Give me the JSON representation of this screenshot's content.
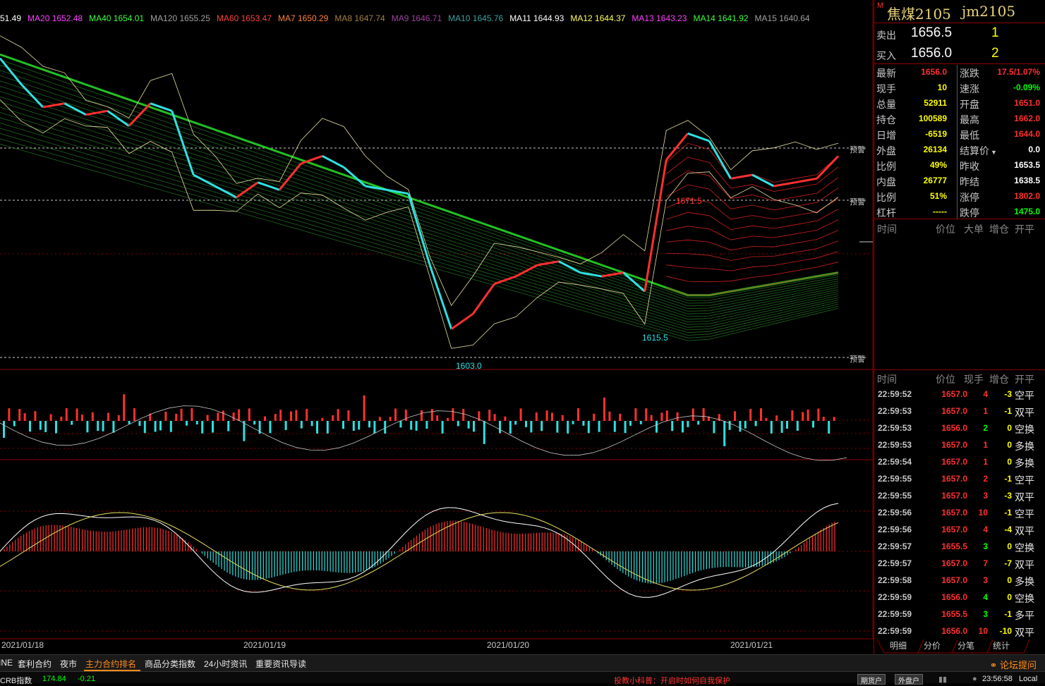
{
  "ma_legend": [
    {
      "label": "51.49",
      "color": "#ffffff"
    },
    {
      "label": "MA20 1652.48",
      "color": "#ff40ff"
    },
    {
      "label": "MA40 1654.01",
      "color": "#40ff40"
    },
    {
      "label": "MA120 1655.25",
      "color": "#a0a0a0"
    },
    {
      "label": "MA60 1653.47",
      "color": "#ff4040"
    },
    {
      "label": "MA7 1650.29",
      "color": "#ff8040"
    },
    {
      "label": "MA8 1647.74",
      "color": "#a08040"
    },
    {
      "label": "MA9 1646.71",
      "color": "#a040a0"
    },
    {
      "label": "MA10 1645.76",
      "color": "#40a0a0"
    },
    {
      "label": "MA11 1644.93",
      "color": "#ffffff"
    },
    {
      "label": "MA12 1644.37",
      "color": "#ffff60"
    },
    {
      "label": "MA13 1643.23",
      "color": "#ff40ff"
    },
    {
      "label": "MA14 1641.92",
      "color": "#40ff40"
    },
    {
      "label": "MA15 1640.64",
      "color": "#a0a0a0"
    }
  ],
  "alerts": [
    "预警",
    "预警",
    "预警"
  ],
  "price_labels": {
    "high": "1671.5",
    "low1": "1615.5",
    "low2": "1603.0"
  },
  "dates": [
    "2021/01/18",
    "2021/01/19",
    "2021/01/20",
    "2021/01/21"
  ],
  "chart_data": {
    "type": "line",
    "ylim": [
      1600,
      1690
    ],
    "x": [
      0,
      1,
      2,
      3,
      4,
      5,
      6,
      7,
      8,
      9,
      10,
      11,
      12,
      13,
      14,
      15,
      16,
      17,
      18,
      19,
      20,
      21,
      22,
      23,
      24,
      25,
      26,
      27,
      28,
      29,
      30,
      31,
      32,
      33,
      34,
      35,
      36,
      37,
      38,
      39
    ],
    "series": [
      {
        "values": [
          1682,
          1675,
          1669,
          1670,
          1667,
          1668,
          1664,
          1670,
          1668,
          1651,
          1648,
          1645,
          1649,
          1647,
          1654,
          1656,
          1653,
          1648,
          1647,
          1646,
          1627,
          1610,
          1614,
          1622,
          1624,
          1627,
          1628,
          1625,
          1624,
          1625,
          1620,
          1655,
          1662,
          1660,
          1650,
          1651,
          1648,
          1649,
          1650,
          1656
        ]
      },
      {
        "values": [
          1683,
          1681,
          1679,
          1677,
          1675,
          1673,
          1671,
          1669,
          1667,
          1665,
          1663,
          1661,
          1659,
          1657,
          1655,
          1653,
          1651,
          1649,
          1647,
          1645,
          1643,
          1641,
          1639,
          1637,
          1635,
          1633,
          1631,
          1629,
          1627,
          1625,
          1623,
          1621,
          1619,
          1619,
          1620,
          1621,
          1622,
          1623,
          1624,
          1625
        ]
      }
    ]
  },
  "panel": {
    "title_marker": "M",
    "name": "焦煤2105",
    "code": "jm2105",
    "ask": {
      "label": "卖出",
      "price": "1656.5",
      "vol": "1"
    },
    "bid": {
      "label": "买入",
      "price": "1656.0",
      "vol": "2"
    },
    "quotes": [
      {
        "l1": "最新",
        "v1": "1656.0",
        "c1": "#ff3030",
        "l2": "涨跌",
        "v2": "17.5/1.07%",
        "c2": "#ff3030"
      },
      {
        "l1": "现手",
        "v1": "10",
        "c1": "#ffff00",
        "l2": "速涨",
        "v2": "-0.09%",
        "c2": "#00ff00"
      },
      {
        "l1": "总量",
        "v1": "52911",
        "c1": "#ffff00",
        "l2": "开盘",
        "v2": "1651.0",
        "c2": "#ff3030"
      },
      {
        "l1": "持仓",
        "v1": "100589",
        "c1": "#ffff00",
        "l2": "最高",
        "v2": "1662.0",
        "c2": "#ff3030"
      },
      {
        "l1": "日增",
        "v1": "-6519",
        "c1": "#ffff00",
        "l2": "最低",
        "v2": "1644.0",
        "c2": "#ff3030"
      },
      {
        "l1": "外盘",
        "v1": "26134",
        "c1": "#ffff00",
        "l2": "结算价",
        "v2": "0.0",
        "c2": "#ffffff",
        "dropdown": true
      },
      {
        "l1": "比例",
        "v1": "49%",
        "c1": "#ffff00",
        "l2": "昨收",
        "v2": "1653.5",
        "c2": "#ffffff"
      },
      {
        "l1": "内盘",
        "v1": "26777",
        "c1": "#ffff00",
        "l2": "昨结",
        "v2": "1638.5",
        "c2": "#ffffff"
      },
      {
        "l1": "比例",
        "v1": "51%",
        "c1": "#ffff00",
        "l2": "涨停",
        "v2": "1802.0",
        "c2": "#ff3030"
      },
      {
        "l1": "杠杆",
        "v1": "-----",
        "c1": "#ffff00",
        "l2": "跌停",
        "v2": "1475.0",
        "c2": "#00ff00"
      }
    ],
    "big_head": [
      "时间",
      "价位",
      "大单",
      "增仓",
      "开平"
    ],
    "tick_head": [
      "时间",
      "价位",
      "现手",
      "增仓",
      "开平"
    ],
    "ticks": [
      {
        "t": "22:59:52",
        "p": "1657.0",
        "s": "4",
        "sc": "#ff3030",
        "z": "-3",
        "k": "空平"
      },
      {
        "t": "22:59:53",
        "p": "1657.0",
        "s": "1",
        "sc": "#ff3030",
        "z": "-1",
        "k": "双平"
      },
      {
        "t": "22:59:53",
        "p": "1656.0",
        "s": "2",
        "sc": "#00ff00",
        "z": "0",
        "k": "空换"
      },
      {
        "t": "22:59:53",
        "p": "1657.0",
        "s": "1",
        "sc": "#ff3030",
        "z": "0",
        "k": "多换"
      },
      {
        "t": "22:59:54",
        "p": "1657.0",
        "s": "1",
        "sc": "#ff3030",
        "z": "0",
        "k": "多换"
      },
      {
        "t": "22:59:55",
        "p": "1657.0",
        "s": "2",
        "sc": "#ff3030",
        "z": "-1",
        "k": "空平"
      },
      {
        "t": "22:59:55",
        "p": "1657.0",
        "s": "3",
        "sc": "#ff3030",
        "z": "-3",
        "k": "双平"
      },
      {
        "t": "22:59:56",
        "p": "1657.0",
        "s": "10",
        "sc": "#ff3030",
        "z": "-1",
        "k": "空平"
      },
      {
        "t": "22:59:56",
        "p": "1657.0",
        "s": "4",
        "sc": "#ff3030",
        "z": "-4",
        "k": "双平"
      },
      {
        "t": "22:59:57",
        "p": "1655.5",
        "s": "3",
        "sc": "#00ff00",
        "z": "0",
        "k": "空换"
      },
      {
        "t": "22:59:57",
        "p": "1657.0",
        "s": "7",
        "sc": "#ff3030",
        "z": "-7",
        "k": "双平"
      },
      {
        "t": "22:59:58",
        "p": "1657.0",
        "s": "3",
        "sc": "#ff3030",
        "z": "0",
        "k": "多换"
      },
      {
        "t": "22:59:59",
        "p": "1656.0",
        "s": "4",
        "sc": "#00ff00",
        "z": "0",
        "k": "空换"
      },
      {
        "t": "22:59:59",
        "p": "1655.5",
        "s": "3",
        "sc": "#00ff00",
        "z": "-1",
        "k": "多平"
      },
      {
        "t": "22:59:59",
        "p": "1656.0",
        "s": "10",
        "sc": "#ff3030",
        "z": "-10",
        "k": "双平"
      }
    ],
    "tabs": [
      "明细",
      "分价",
      "分笔",
      "统计"
    ]
  },
  "bottom_tabs": [
    {
      "label": "INE",
      "active": false
    },
    {
      "label": "套利合约",
      "active": false
    },
    {
      "label": "夜市",
      "active": false
    },
    {
      "label": "主力合约排名",
      "active": true
    },
    {
      "label": "商品分类指数",
      "active": false
    },
    {
      "label": "24小时资讯",
      "active": false
    },
    {
      "label": "重要资讯导读",
      "active": false
    }
  ],
  "forum": "论坛提问",
  "status": {
    "index_label": "CRB指数",
    "index_value": "174.84",
    "index_change": "-0.21",
    "tip": "投教小科普：开启时如何自我保护",
    "btn1": "期货户",
    "btn2": "外盘户",
    "time": "23:56:58",
    "local": "Local"
  },
  "colors": {
    "up": "#ff3030",
    "down": "#30e0e0",
    "grid": "#8b0000",
    "ma_green": "#22c022"
  }
}
